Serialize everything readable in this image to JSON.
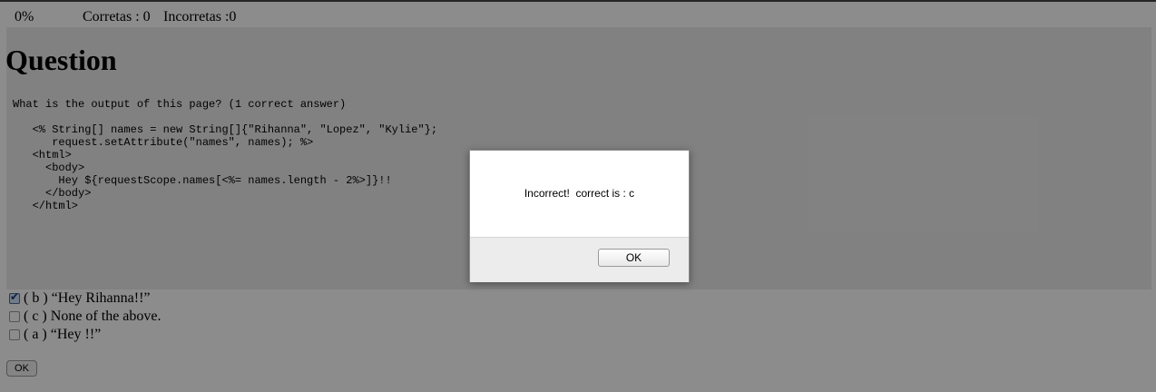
{
  "status": {
    "progress_text": "0%",
    "correct_text": "Corretas : 0",
    "incorrect_text": "Incorretas :0"
  },
  "question": {
    "title": "Question",
    "prompt": "What is the output of this page? (1 correct answer)",
    "code": "   <% String[] names = new String[]{\"Rihanna\", \"Lopez\", \"Kylie\"};\n      request.setAttribute(\"names\", names); %>\n   <html>\n     <body>\n       Hey ${requestScope.names[<%= names.length - 2%>]}!!\n     </body>\n   </html>"
  },
  "answers": [
    {
      "label": "( b ) “Hey Rihanna!!”",
      "checked": true
    },
    {
      "label": "( c ) None of the above.",
      "checked": false
    },
    {
      "label": "( a ) “Hey !!”",
      "checked": false
    }
  ],
  "submit_label": "OK",
  "dialog": {
    "message": "Incorrect!  correct is : c",
    "ok_label": "OK"
  }
}
